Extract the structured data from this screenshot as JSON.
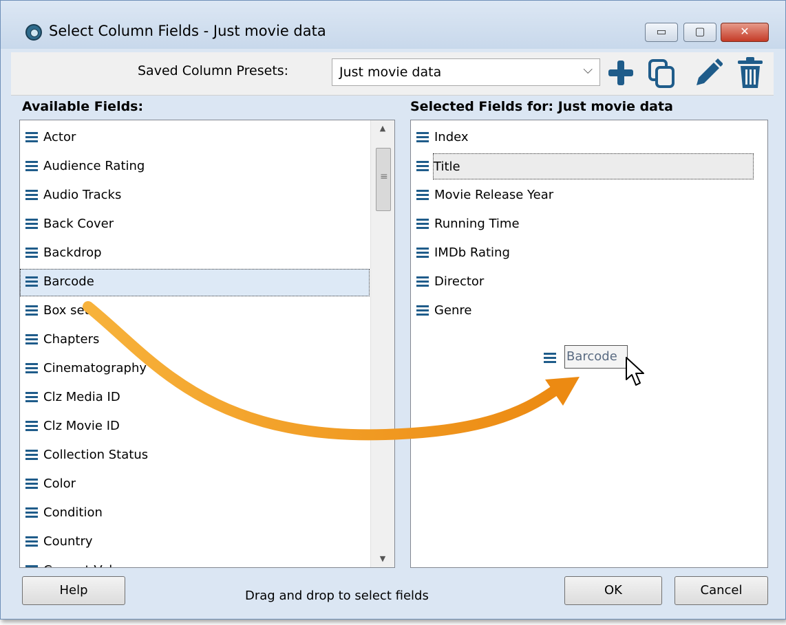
{
  "window": {
    "title": "Select Column Fields - Just movie data",
    "controls": {
      "minimize": "▭",
      "maximize": "▢",
      "close": "✕"
    }
  },
  "toolbar": {
    "presets_label": "Saved Column Presets:",
    "preset_value": "Just movie data",
    "icons": [
      "plus-icon",
      "copy-icon",
      "pencil-icon",
      "trash-icon"
    ],
    "accent": "#1f5c8a"
  },
  "available": {
    "header": "Available Fields:",
    "items": [
      "Actor",
      "Audience Rating",
      "Audio Tracks",
      "Back Cover",
      "Backdrop",
      "Barcode",
      "Box set",
      "Chapters",
      "Cinematography",
      "Clz Media ID",
      "Clz Movie ID",
      "Collection Status",
      "Color",
      "Condition",
      "Country",
      "Current Value"
    ],
    "selected_item": "Barcode"
  },
  "selected": {
    "header": "Selected Fields for: Just movie data",
    "items": [
      "Index",
      "Title",
      "Movie Release Year",
      "Running Time",
      "IMDb Rating",
      "Director",
      "Genre"
    ],
    "focused_item": "Title"
  },
  "drag": {
    "label": "Barcode"
  },
  "footer": {
    "help": "Help",
    "hint": "Drag and drop to select fields",
    "ok": "OK",
    "cancel": "Cancel"
  },
  "colors": {
    "arrow": "#f0a01e",
    "icon_blue": "#1f5c8a",
    "selection": "#dde9f6"
  }
}
